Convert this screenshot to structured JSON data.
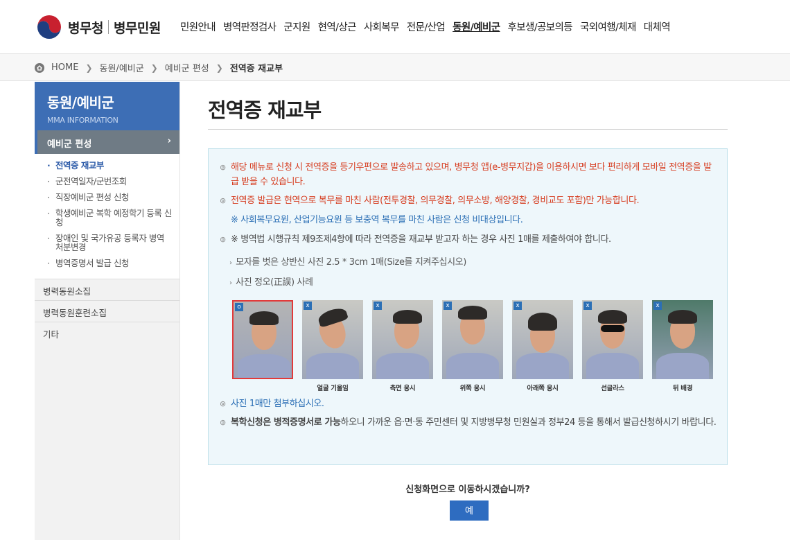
{
  "header": {
    "logo_name": "병무청",
    "logo_sub": "병무민원",
    "menu": [
      "민원안내",
      "병역판정검사",
      "군지원",
      "현역/상근",
      "사회복무",
      "전문/산업",
      "동원/예비군",
      "후보생/공보의등",
      "국외여행/체재",
      "대체역"
    ],
    "active_menu": "동원/예비군"
  },
  "breadcrumb": {
    "home": "HOME",
    "items": [
      "동원/예비군",
      "예비군 편성"
    ],
    "current": "전역증 재교부"
  },
  "sidebar": {
    "title": "동원/예비군",
    "subtitle": "MMA INFORMATION",
    "category": "예비군 편성",
    "subitems": [
      "전역증 재교부",
      "군전역일자/군번조회",
      "직장예비군 편성 신청",
      "학생예비군 복학 예정학기 등록 신청",
      "장애인 및 국가유공 등록자 병역 처분변경",
      "병역증명서 발급 신청"
    ],
    "items": [
      "병력동원소집",
      "병력동원훈련소집",
      "기타"
    ]
  },
  "main": {
    "title": "전역증 재교부",
    "notice": {
      "item1": "해당 메뉴로 신청 시 전역증을 등기우편으로 발송하고 있으며, 병무청 앱(e-병무지갑)을 이용하시면 보다 편리하게 모바일 전역증을 발급 받을 수 있습니다.",
      "item2": "전역증 발급은 현역으로 복무를 마친 사람(전투경찰, 의무경찰, 의무소방, 해양경찰, 경비교도 포함)만 가능합니다.",
      "item2_note": "※ 사회복무요원, 산업기능요원 등 보충역 복무를 마친 사람은 신청 비대상입니다.",
      "item3": "※ 병역법 시행규칙 제9조제4항에 따라 전역증을 재교부 받고자 하는 경우 사진 1매를 제출하여야 합니다.",
      "sub1": "모자를 벗은 상반신 사진 2.5 * 3cm 1매(Size를 지켜주십시오)",
      "sub2": "사진 정오(正誤) 사례",
      "item4": "사진 1매만 첨부하십시오.",
      "item5_bold1": "복학신청은 병적증명서로 가능",
      "item5_rest": "하오니 가까운 읍·면·동 주민센터 및 지방병무청 민원실과 정부24 등을 통해서 발급신청하시기 바랍니다."
    },
    "photos": [
      {
        "badge": "o",
        "caption": ""
      },
      {
        "badge": "x",
        "caption": "얼굴 기울임"
      },
      {
        "badge": "x",
        "caption": "측면 응시"
      },
      {
        "badge": "x",
        "caption": "위쪽 응시"
      },
      {
        "badge": "x",
        "caption": "아래쪽 응시"
      },
      {
        "badge": "x",
        "caption": "선글라스"
      },
      {
        "badge": "x",
        "caption": "뒤 배경"
      }
    ],
    "confirm_text": "신청화면으로 이동하시겠습니까?",
    "yes_label": "예"
  },
  "colors": {
    "accent": "#3d6eb5",
    "warning": "#d63c1f",
    "info": "#2b6fb5",
    "button": "#2e6cc0"
  }
}
